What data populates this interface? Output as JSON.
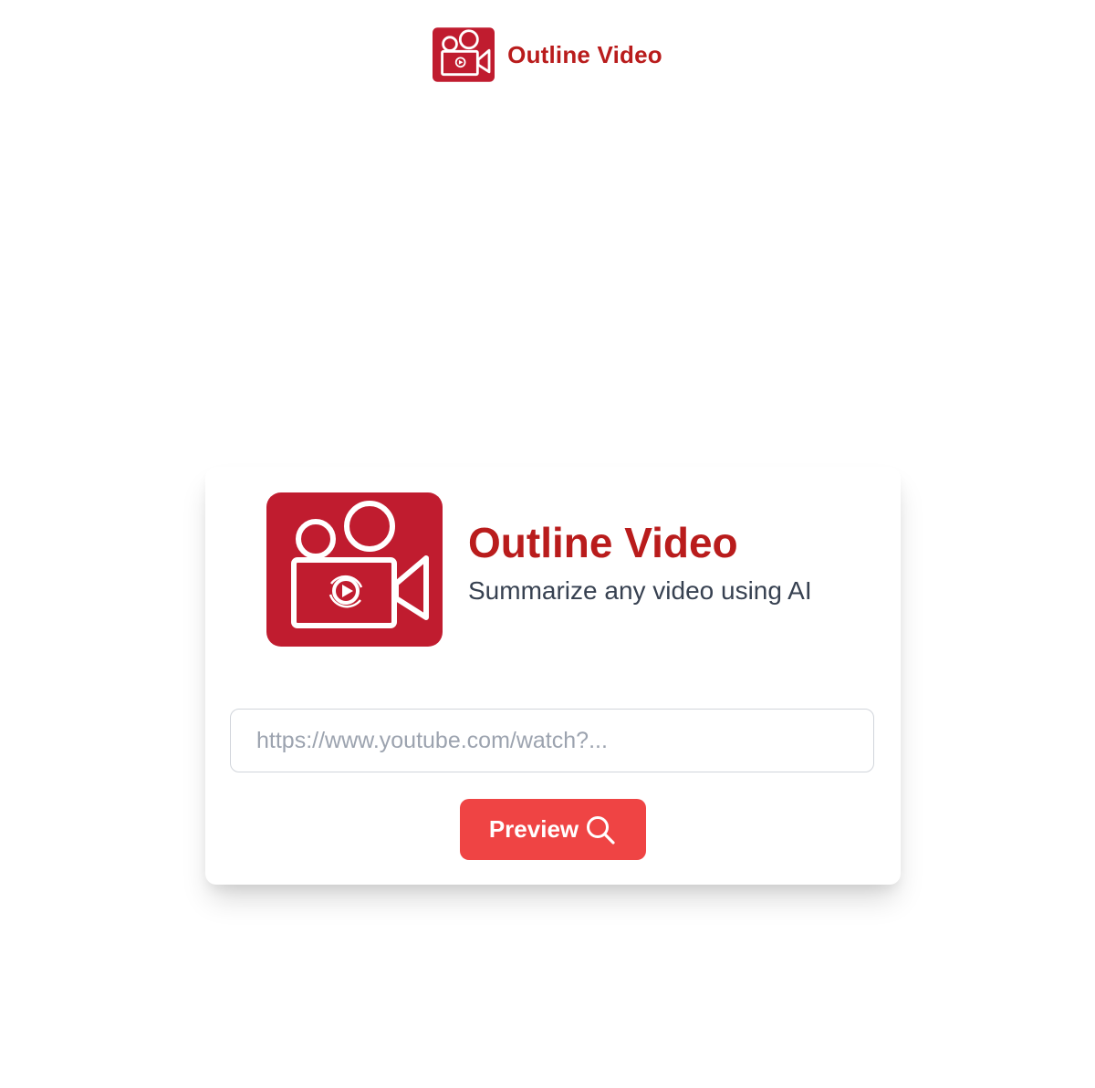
{
  "colors": {
    "brand": "#b91c1c",
    "logo_bg": "#c01c2f",
    "button": "#ef4444",
    "subtitle": "#374151",
    "placeholder": "#9ca3af"
  },
  "header": {
    "logo_icon": "video-camera-icon",
    "title": "Outline Video"
  },
  "hero": {
    "logo_icon": "video-camera-icon",
    "title": "Outline Video",
    "subtitle": "Summarize any video using AI"
  },
  "form": {
    "url_value": "",
    "url_placeholder": "https://www.youtube.com/watch?...",
    "preview_label": "Preview",
    "preview_icon": "search-icon"
  }
}
